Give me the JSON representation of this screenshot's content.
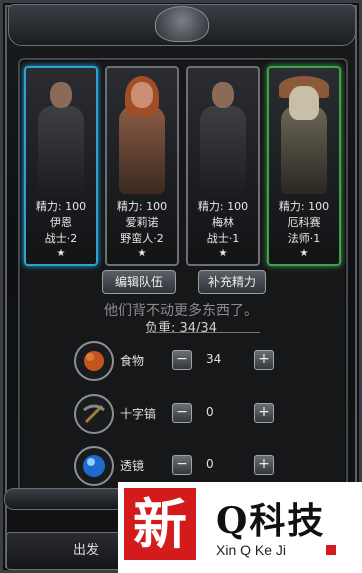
{
  "party": [
    {
      "stamina_label": "精力: 100",
      "name": "伊恩",
      "class_level": "战士·2",
      "stars": "★",
      "selected": true,
      "accent": "#2aa3d6",
      "portrait": "warrior"
    },
    {
      "stamina_label": "精力: 100",
      "name": "爱莉诺",
      "class_level": "野蛮人·2",
      "stars": "★",
      "selected": false,
      "accent": "#6d6f72",
      "portrait": "barbarian"
    },
    {
      "stamina_label": "精力: 100",
      "name": "梅林",
      "class_level": "战士·1",
      "stars": "★",
      "selected": false,
      "accent": "#6d6f72",
      "portrait": "warrior"
    },
    {
      "stamina_label": "精力: 100",
      "name": "厄科赛",
      "class_level": "法师·1",
      "stars": "★",
      "selected": false,
      "accent": "#3aa54a",
      "portrait": "shaman"
    }
  ],
  "buttons": {
    "edit_team": "编辑队伍",
    "replenish": "补充精力",
    "depart": "出发"
  },
  "hint": "他们背不动更多东西了。",
  "load_label": "负重: 34/34",
  "items": [
    {
      "name": "食物",
      "qty": "34",
      "icon": "food-sack-icon"
    },
    {
      "name": "十字镐",
      "qty": "0",
      "icon": "pickaxe-icon"
    },
    {
      "name": "透镜",
      "qty": "0",
      "icon": "lens-icon"
    }
  ],
  "controls": {
    "minus": "−",
    "plus": "+"
  },
  "watermark": {
    "logo": "新",
    "title": "Q科技",
    "sub": "Xin Q Ke Ji"
  }
}
